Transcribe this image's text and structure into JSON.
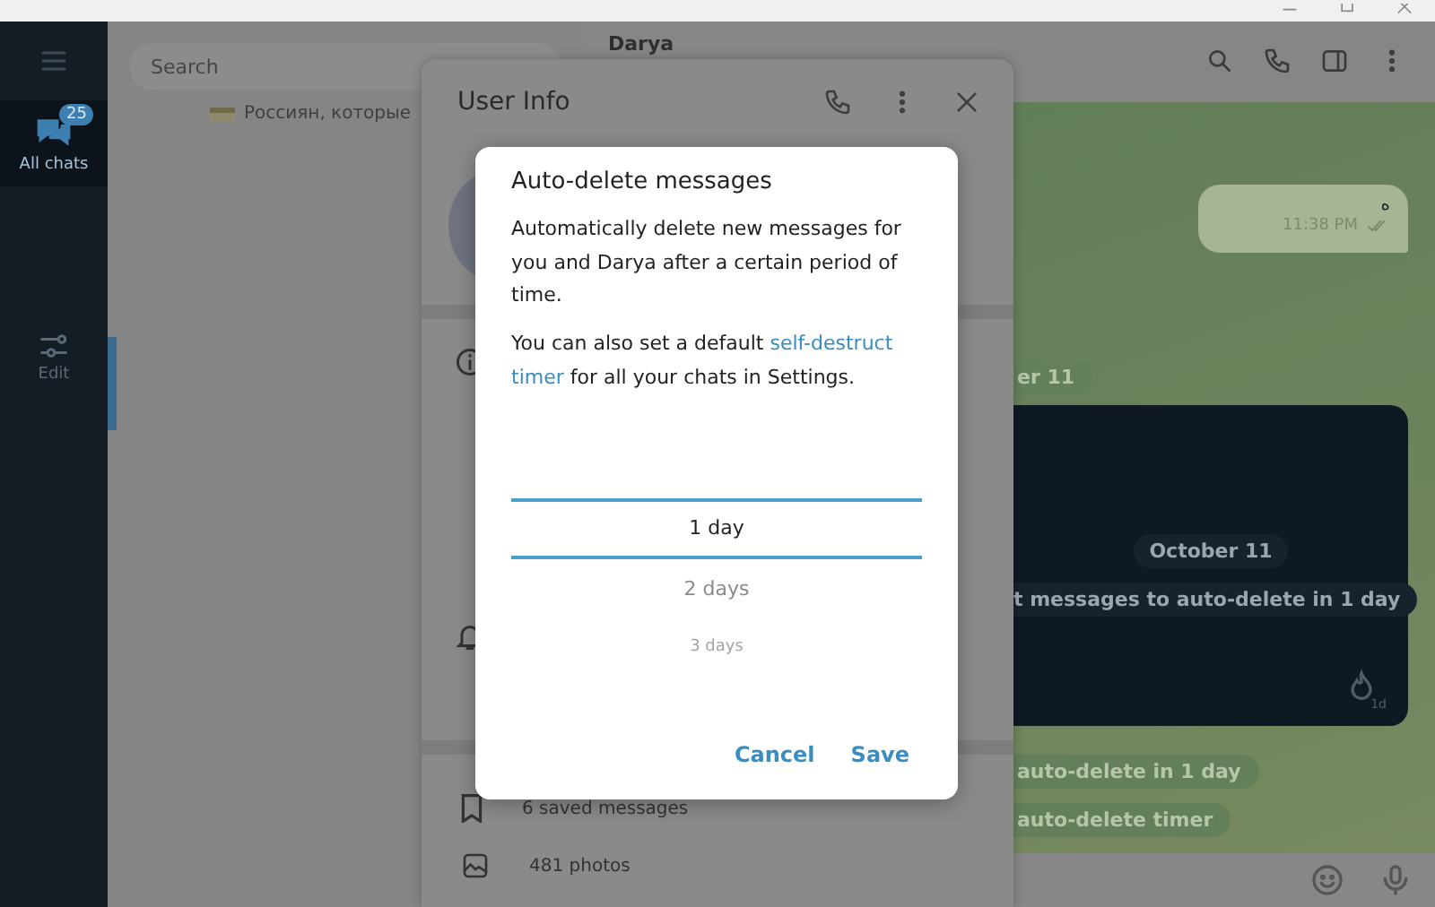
{
  "sidebar": {
    "folders": [
      {
        "kind": "folder",
        "label": "All chats",
        "badge": "25",
        "selected": true
      },
      {
        "kind": "edit",
        "label": "Edit",
        "selected": false
      }
    ]
  },
  "chat_list": {
    "search": {
      "placeholder": "Search"
    },
    "preview": "Россиян, которые"
  },
  "chat_header": {
    "name": "Darya"
  },
  "user_info": {
    "title": "User Info",
    "rows": [
      {
        "kind": "saved",
        "label": "6 saved messages"
      },
      {
        "kind": "photos",
        "label": "481 photos"
      }
    ]
  },
  "chat": {
    "outgoing": {
      "text": "ه",
      "time": "11:38 PM"
    },
    "date_pill": "er 11",
    "card": {
      "date": "October 11",
      "service": "t messages to auto-delete in 1 day",
      "timer": "1d"
    },
    "pills": [
      "auto-delete in 1 day",
      "auto-delete timer"
    ]
  },
  "dialog": {
    "title": "Auto-delete messages",
    "text": "Automatically delete new messages for you and Darya after a certain period of time.",
    "note_lines": [
      {
        "before": "You can also set a default ",
        "link": "self-destruct"
      },
      {
        "link": "timer",
        "after": " for all your chats in Settings."
      }
    ],
    "options": [
      {
        "label": "1 day",
        "selected": true
      },
      {
        "label": "2 days",
        "selected": false
      },
      {
        "label": "3 days",
        "selected": false
      }
    ],
    "buttons": [
      "Cancel",
      "Save"
    ]
  }
}
